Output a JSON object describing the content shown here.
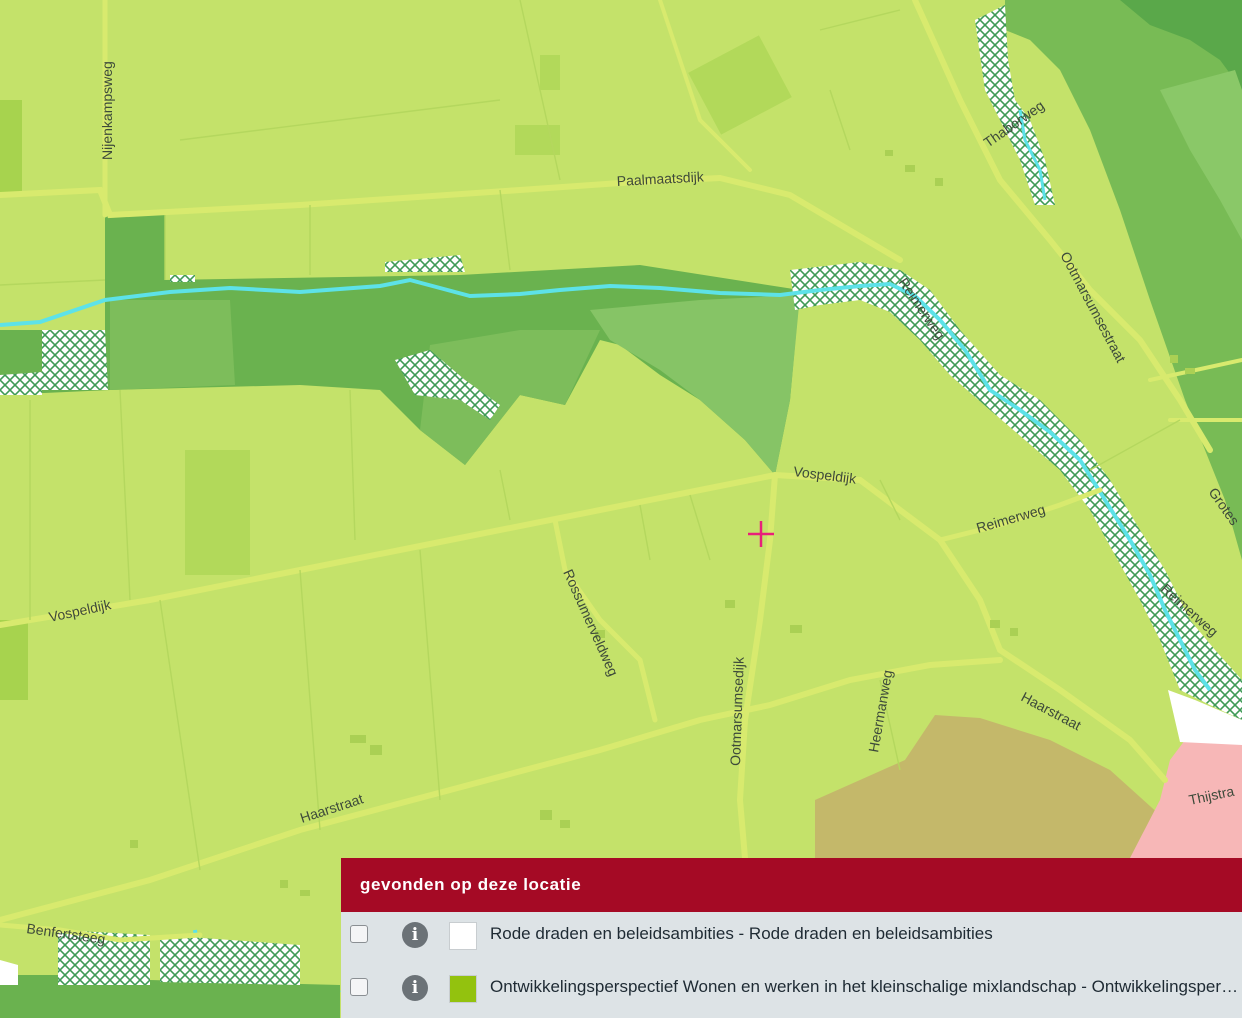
{
  "map": {
    "road_labels": {
      "nijenkampsweg": "Nijenkampsweg",
      "paalmaatsdijk": "Paalmaatsdijk",
      "thaborweg": "Thaborweg",
      "reimerweg_1": "Reimerweg",
      "reimerweg_2": "Reimerweg",
      "reimerweg_3": "Reimerweg",
      "ootmarsumsestraat": "Ootmarsumsestraat",
      "vospeldijk_1": "Vospeldijk",
      "vospeldijk_2": "Vospeldijk",
      "grotestraat": "Grotes",
      "rossumerveldweg": "Rossumerveldweg",
      "ootmarsumsedijk": "Ootmarsumsedijk",
      "heermanweg": "Heermanweg",
      "haarstraat_1": "Haarstraat",
      "haarstraat_2": "Haarstraat",
      "thijstraat": "Thijstra",
      "benfertsteeg": "Benfertsteeg"
    },
    "colors": {
      "base": "#c4e26a",
      "road": "#d8ea6e",
      "water": "#5de2e8",
      "forest": "#6ab24f",
      "forest_light": "#86c466",
      "brown_zone": "#c4b86a",
      "urban": "#f7b7b7",
      "marker": "#e8207a"
    },
    "marker_icon": "crosshair-icon"
  },
  "panel": {
    "title": "gevonden op deze locatie",
    "rows": [
      {
        "label": "Rode draden en beleidsambities - Rode draden en beleidsambities",
        "swatch_color": "#ffffff",
        "info_icon": "i"
      },
      {
        "label": "Ontwikkelingsperspectief Wonen en werken in het kleinschalige mixlandschap - Ontwikkelingsperspectief Wonen en werken in het kleinschalige mixlandschap",
        "swatch_color": "#93c20e",
        "info_icon": "i"
      }
    ]
  }
}
